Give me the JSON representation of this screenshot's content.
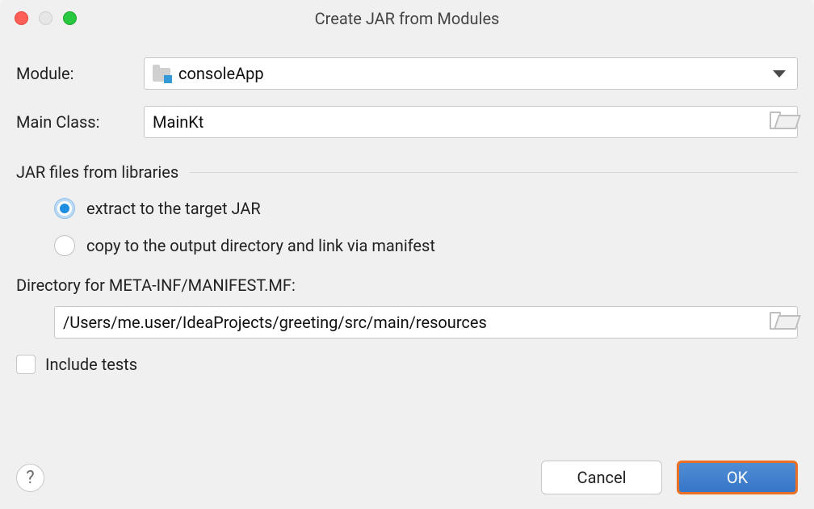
{
  "window": {
    "title": "Create JAR from Modules"
  },
  "form": {
    "module_label": "Module:",
    "module_value": "consoleApp",
    "main_class_label": "Main Class:",
    "main_class_value": "MainKt"
  },
  "libraries_section": {
    "title": "JAR files from libraries",
    "options": [
      {
        "label": "extract to the target JAR",
        "selected": true
      },
      {
        "label": "copy to the output directory and link via manifest",
        "selected": false
      }
    ]
  },
  "directory": {
    "label": "Directory for META-INF/MANIFEST.MF:",
    "value": "/Users/me.user/IdeaProjects/greeting/src/main/resources"
  },
  "include_tests": {
    "label": "Include tests",
    "checked": false
  },
  "buttons": {
    "help": "?",
    "cancel": "Cancel",
    "ok": "OK"
  }
}
